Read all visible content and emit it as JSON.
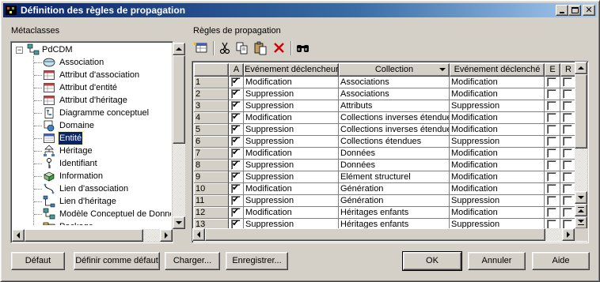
{
  "window": {
    "title": "Définition des règles de propagation"
  },
  "left_panel": {
    "label": "Métaclasses",
    "root": "PdCDM",
    "items": [
      {
        "label": "Association",
        "icon": "association-icon"
      },
      {
        "label": "Attribut d'association",
        "icon": "table-icon"
      },
      {
        "label": "Attribut d'entité",
        "icon": "table-icon"
      },
      {
        "label": "Attribut d'héritage",
        "icon": "table-icon"
      },
      {
        "label": "Diagramme conceptuel",
        "icon": "diagram-icon"
      },
      {
        "label": "Domaine",
        "icon": "domain-icon"
      },
      {
        "label": "Entité",
        "icon": "entity-icon",
        "selected": true
      },
      {
        "label": "Héritage",
        "icon": "inheritance-icon"
      },
      {
        "label": "Identifiant",
        "icon": "key-icon"
      },
      {
        "label": "Information",
        "icon": "information-icon"
      },
      {
        "label": "Lien d'association",
        "icon": "link-icon"
      },
      {
        "label": "Lien d'héritage",
        "icon": "inheritance-link-icon"
      },
      {
        "label": "Modèle Conceptuel de Donné",
        "icon": "model-icon"
      },
      {
        "label": "Package",
        "icon": "package-icon"
      }
    ]
  },
  "right_panel": {
    "label": "Règles de propagation",
    "toolbar": [
      "add-row-icon",
      "cut-icon",
      "copy-icon",
      "paste-icon",
      "delete-icon",
      "find-icon"
    ],
    "columns": {
      "a": "A",
      "trigger": "Evénement déclencheur",
      "collection": "Collection",
      "triggered": "Evénement déclenché",
      "e": "E",
      "r": "R"
    },
    "rows": [
      {
        "n": "1",
        "trigger": "Modification",
        "collection": "Associations",
        "triggered": "Modification"
      },
      {
        "n": "2",
        "trigger": "Suppression",
        "collection": "Associations",
        "triggered": "Modification"
      },
      {
        "n": "3",
        "trigger": "Suppression",
        "collection": "Attributs",
        "triggered": "Suppression"
      },
      {
        "n": "4",
        "trigger": "Modification",
        "collection": "Collections inverses étendues",
        "triggered": "Modification"
      },
      {
        "n": "5",
        "trigger": "Suppression",
        "collection": "Collections inverses étendues",
        "triggered": "Modification"
      },
      {
        "n": "6",
        "trigger": "Suppression",
        "collection": "Collections étendues",
        "triggered": "Suppression"
      },
      {
        "n": "7",
        "trigger": "Modification",
        "collection": "Données",
        "triggered": "Modification"
      },
      {
        "n": "8",
        "trigger": "Suppression",
        "collection": "Données",
        "triggered": "Modification"
      },
      {
        "n": "9",
        "trigger": "Suppression",
        "collection": "Elément structurel",
        "triggered": "Modification"
      },
      {
        "n": "10",
        "trigger": "Modification",
        "collection": "Génération",
        "triggered": "Modification"
      },
      {
        "n": "11",
        "trigger": "Suppression",
        "collection": "Génération",
        "triggered": "Suppression"
      },
      {
        "n": "12",
        "trigger": "Modification",
        "collection": "Héritages enfants",
        "triggered": "Modification"
      },
      {
        "n": "13",
        "trigger": "Suppression",
        "collection": "Héritages enfants",
        "triggered": "Suppression"
      }
    ]
  },
  "buttons": {
    "default": "Défaut",
    "set_default": "Définir comme défaut",
    "load": "Charger...",
    "save": "Enregistrer...",
    "ok": "OK",
    "cancel": "Annuler",
    "help": "Aide"
  }
}
